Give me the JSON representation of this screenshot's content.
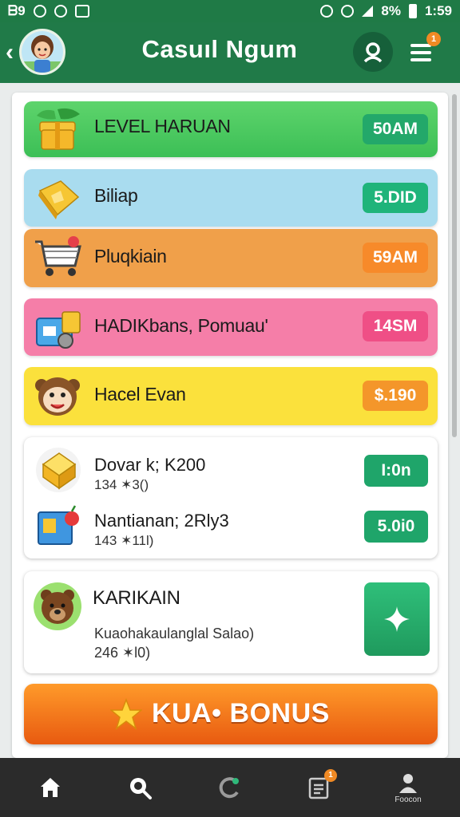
{
  "status_bar": {
    "left_text": "ᗷ9",
    "battery": "8%",
    "time": "1:59"
  },
  "header": {
    "title": "Casuıl Ngum",
    "menu_badge": "1"
  },
  "rows": [
    {
      "label": "LEVEL HARUAN",
      "value": "50AM",
      "icon": "gift-box-icon"
    },
    {
      "label": "Biliap",
      "value": "5.DID",
      "icon": "gold-cube-icon"
    },
    {
      "label": "Pluqkiain",
      "value": "59AM",
      "icon": "shopping-cart-icon"
    },
    {
      "label": "HADIKbans, Pomuau'",
      "value": "14SM",
      "icon": "treasure-bin-icon"
    },
    {
      "label": "Hacel Evan",
      "value": "$.190",
      "icon": "monkey-face-icon"
    }
  ],
  "sub_items": [
    {
      "title": "Dovar k; K200",
      "subtitle": "134 ✶3()",
      "value": "I:0n",
      "icon": "gold-cube-icon"
    },
    {
      "title": "Nantianan; 2Rly3",
      "subtitle": "143 ✶11l)",
      "value": "5.0i0",
      "icon": "blue-basket-icon"
    }
  ],
  "featured": {
    "title": "KARIKAIN",
    "subtitle": "Kuaohakaulanglal Salao)",
    "detail": "246 ✶l0)",
    "icon": "bear-icon",
    "action_icon": "plus-icon"
  },
  "bonus": {
    "label": "KUA• BONUS",
    "icon": "star-icon"
  },
  "bottom_nav": [
    {
      "icon": "home-icon",
      "label": ""
    },
    {
      "icon": "search-icon",
      "label": ""
    },
    {
      "icon": "refresh-icon",
      "label": ""
    },
    {
      "icon": "notes-icon",
      "label": "",
      "badge": "1"
    },
    {
      "icon": "person-icon",
      "label": "Foocon"
    }
  ],
  "colors": {
    "header_green": "#207a48",
    "row_green": "#4ec862",
    "row_blue": "#a9dcef",
    "row_orange": "#f0a04a",
    "row_pink": "#f57ea8",
    "row_yellow": "#fbe13c",
    "bonus_orange": "#f07018"
  }
}
